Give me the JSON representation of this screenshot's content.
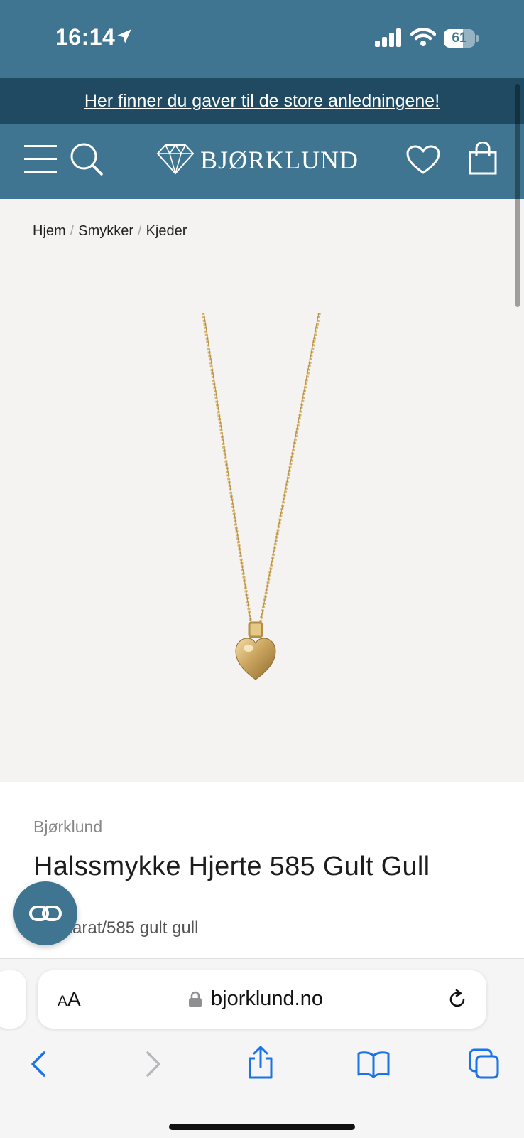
{
  "status_bar": {
    "time": "16:14",
    "battery_level": "61",
    "battery_fraction": 0.61,
    "icons": [
      "location-arrow-icon",
      "cellular-signal-icon",
      "wifi-icon",
      "battery-icon"
    ]
  },
  "promo_banner": {
    "text": "Her finner du gaver til de store anledningene!"
  },
  "header": {
    "logo_text": "BJØRKLUND",
    "icons": [
      "menu-icon",
      "search-icon",
      "diamond-logo-icon",
      "heart-icon",
      "shopping-bag-icon"
    ]
  },
  "breadcrumb": {
    "items": [
      "Hjem",
      "Smykker",
      "Kjeder"
    ],
    "separator": "/"
  },
  "product": {
    "brand": "Bjørklund",
    "title": "Halssmykke Hjerte 585 Gult Gull",
    "spec_partial": "karat/585 gult gull",
    "image": "gold-heart-necklace"
  },
  "chat": {
    "icon": "chat-link-icon"
  },
  "browser": {
    "text_size_label_small": "A",
    "text_size_label_large": "A",
    "url": "bjorklund.no",
    "icons": [
      "lock-icon",
      "reload-icon",
      "back-icon",
      "forward-icon",
      "share-icon",
      "bookmarks-icon",
      "tabs-icon"
    ]
  },
  "colors": {
    "brand_blue": "#3f7590",
    "banner_dark": "#1f4a62",
    "ios_blue": "#1a73e8",
    "gallery_bg": "#f5f3f1"
  }
}
